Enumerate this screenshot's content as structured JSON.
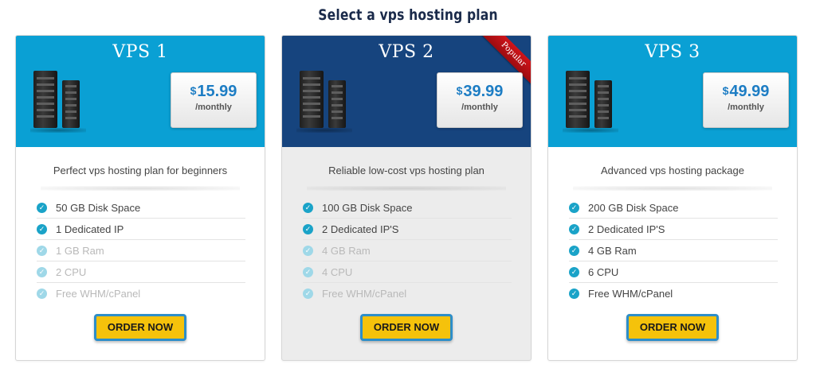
{
  "page": {
    "title": "Select a vps hosting plan"
  },
  "colors": {
    "header_blue": "#0aa0d4",
    "header_dark": "#16447e",
    "price_text": "#1d7dc4",
    "check": "#1aa3c8",
    "button": "#f5c20b",
    "button_border": "#2d8ec9",
    "ribbon": "#c2121a"
  },
  "plans": [
    {
      "name": "VPS 1",
      "currency": "$",
      "price": "15.99",
      "period": "/monthly",
      "tagline": "Perfect vps hosting plan for beginners",
      "features": [
        {
          "label": "50 GB Disk Space",
          "enabled": true
        },
        {
          "label": "1 Dedicated IP",
          "enabled": true
        },
        {
          "label": "1 GB Ram",
          "enabled": false
        },
        {
          "label": "2 CPU",
          "enabled": false
        },
        {
          "label": "Free WHM/cPanel",
          "enabled": false
        }
      ],
      "button": "ORDER NOW",
      "server_icon": "server-rack-icon"
    },
    {
      "name": "VPS 2",
      "currency": "$",
      "price": "39.99",
      "period": "/monthly",
      "tagline": "Reliable low-cost vps hosting plan",
      "badge": "Popular",
      "features": [
        {
          "label": "100 GB Disk Space",
          "enabled": true
        },
        {
          "label": "2 Dedicated IP'S",
          "enabled": true
        },
        {
          "label": "4 GB Ram",
          "enabled": false
        },
        {
          "label": "4 CPU",
          "enabled": false
        },
        {
          "label": "Free WHM/cPanel",
          "enabled": false
        }
      ],
      "button": "ORDER NOW",
      "server_icon": "server-rack-icon"
    },
    {
      "name": "VPS 3",
      "currency": "$",
      "price": "49.99",
      "period": "/monthly",
      "tagline": "Advanced vps hosting package",
      "features": [
        {
          "label": "200 GB Disk Space",
          "enabled": true
        },
        {
          "label": "2 Dedicated IP'S",
          "enabled": true
        },
        {
          "label": "4 GB Ram",
          "enabled": true
        },
        {
          "label": "6 CPU",
          "enabled": true
        },
        {
          "label": "Free WHM/cPanel",
          "enabled": true
        }
      ],
      "button": "ORDER NOW",
      "server_icon": "server-rack-icon"
    }
  ]
}
